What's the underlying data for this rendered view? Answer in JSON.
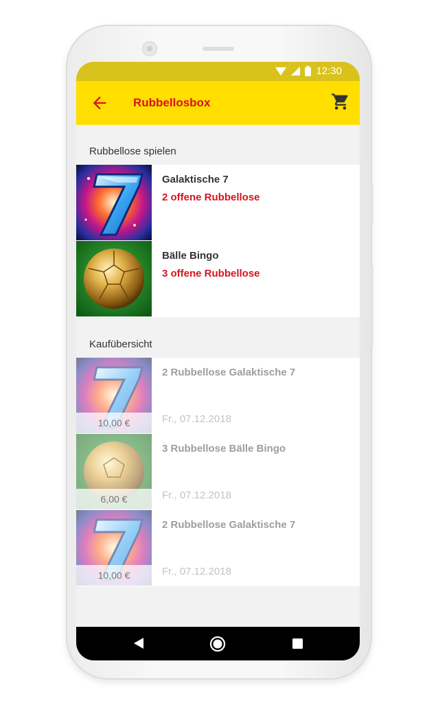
{
  "status_bar": {
    "time": "12:30",
    "icons": [
      "wifi-icon",
      "signal-icon",
      "battery-icon"
    ]
  },
  "app_bar": {
    "title": "Rubbellosbox",
    "back_icon": "back-arrow-icon",
    "cart_icon": "cart-icon"
  },
  "play_section": {
    "header": "Rubbellose spielen",
    "items": [
      {
        "name": "Galaktische 7",
        "status": "2 offene Rubbellose",
        "thumb": "galaktische-7"
      },
      {
        "name": "Bälle Bingo",
        "status": "3 offene Rubbellose",
        "thumb": "baelle-bingo"
      }
    ]
  },
  "purchase_section": {
    "header": "Kaufübersicht",
    "items": [
      {
        "title": "2 Rubbellose Galaktische 7",
        "date": "Fr., 07.12.2018",
        "price": "10,00 €",
        "thumb": "galaktische-7"
      },
      {
        "title": "3 Rubbellose Bälle Bingo",
        "date": "Fr., 07.12.2018",
        "price": "6,00 €",
        "thumb": "baelle-bingo"
      },
      {
        "title": "2 Rubbellose Galaktische 7",
        "date": "Fr., 07.12.2018",
        "price": "10,00 €",
        "thumb": "galaktische-7"
      }
    ]
  },
  "nav_bar": {
    "icons": [
      "nav-back-icon",
      "nav-home-icon",
      "nav-recents-icon"
    ]
  },
  "colors": {
    "app_bar": "#ffde00",
    "status_bar": "#d9c21c",
    "accent_red": "#d7141c"
  }
}
